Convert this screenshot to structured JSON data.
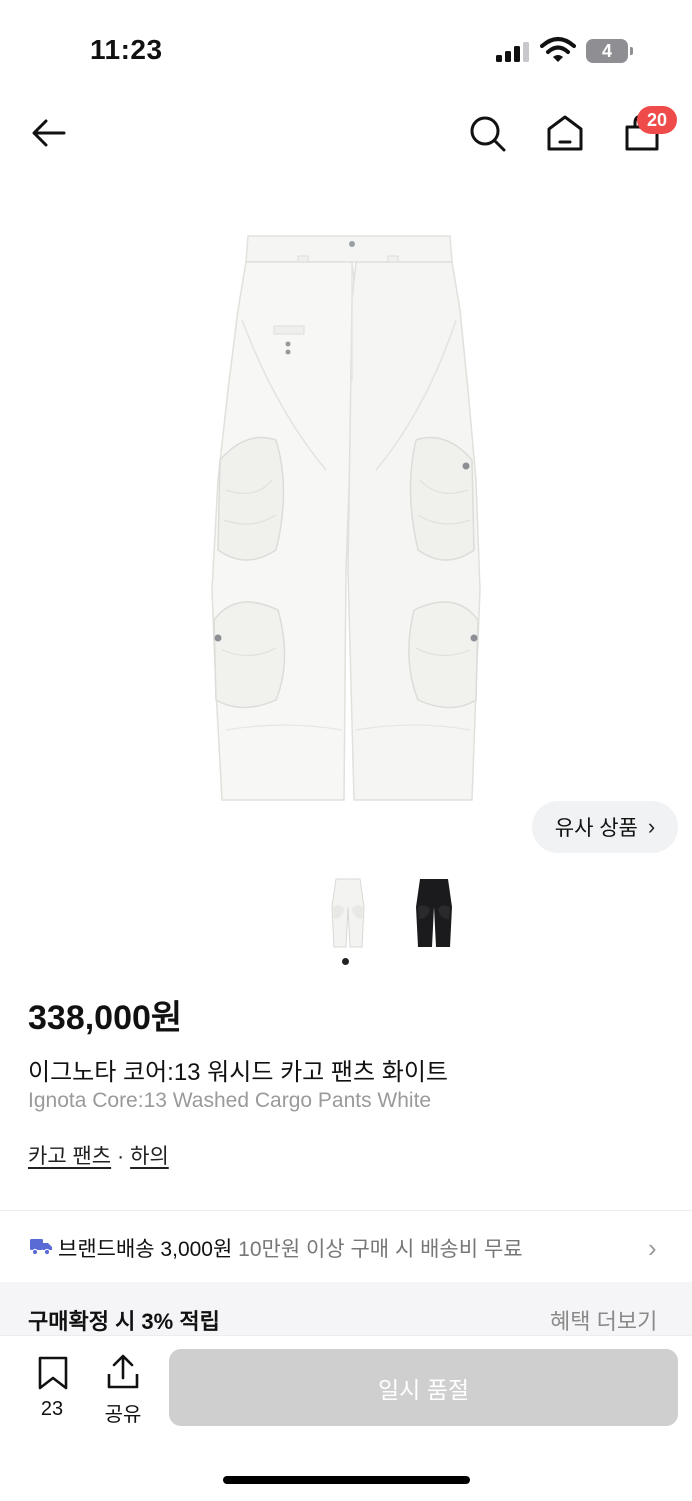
{
  "status_bar": {
    "time": "11:23",
    "battery_level": "4"
  },
  "header": {
    "cart_badge": "20"
  },
  "product": {
    "similar_label": "유사 상품",
    "price": "338,000원",
    "title_ko": "이그노타 코어:13 워시드 카고 팬츠 화이트",
    "title_en": "Ignota Core:13 Washed Cargo Pants White",
    "categories": [
      "카고 팬츠",
      "하의"
    ],
    "category_separator": "·"
  },
  "shipping": {
    "label": "브랜드배송 3,000원",
    "note": "10만원 이상 구매 시 배송비 무료"
  },
  "benefit": {
    "title": "구매확정 시 3% 적립",
    "more": "혜택 더보기"
  },
  "bottom_bar": {
    "bookmark_count": "23",
    "share_label": "공유",
    "buy_button": "일시 품절"
  },
  "colors": {
    "badge": "#f04b4b",
    "truck": "#5b6bd6",
    "soldout_button": "#cfcfcf"
  }
}
